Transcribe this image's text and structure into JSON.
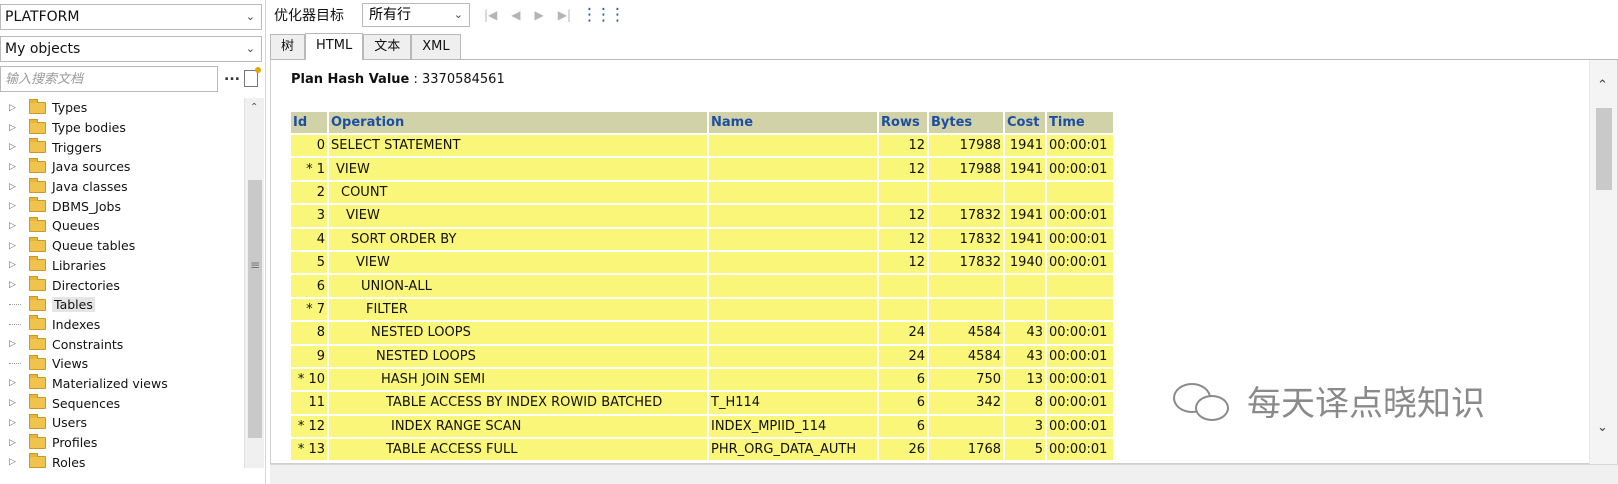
{
  "left_panel": {
    "schema_combo": "PLATFORM",
    "filter_combo": "My objects",
    "search_placeholder": "输入搜索文档",
    "more_button": "...",
    "tree": [
      {
        "label": "Types",
        "folder": true
      },
      {
        "label": "Type bodies",
        "folder": true
      },
      {
        "label": "Triggers",
        "folder": true
      },
      {
        "label": "Java sources",
        "folder": true
      },
      {
        "label": "Java classes",
        "folder": true
      },
      {
        "label": "DBMS_Jobs",
        "folder": true
      },
      {
        "label": "Queues",
        "folder": true
      },
      {
        "label": "Queue tables",
        "folder": true
      },
      {
        "label": "Libraries",
        "folder": true
      },
      {
        "label": "Directories",
        "folder": true
      },
      {
        "label": "Tables",
        "folder": false,
        "selected": true
      },
      {
        "label": "Indexes",
        "folder": false
      },
      {
        "label": "Constraints",
        "folder": true
      },
      {
        "label": "Views",
        "folder": false
      },
      {
        "label": "Materialized views",
        "folder": true
      },
      {
        "label": "Sequences",
        "folder": true
      },
      {
        "label": "Users",
        "folder": true
      },
      {
        "label": "Profiles",
        "folder": true
      },
      {
        "label": "Roles",
        "folder": true
      }
    ]
  },
  "toolbar": {
    "optimizer_label": "优化器目标",
    "optimizer_value": "所有行"
  },
  "tabs": [
    {
      "label": "树",
      "active": false
    },
    {
      "label": "HTML",
      "active": true
    },
    {
      "label": "文本",
      "active": false
    },
    {
      "label": "XML",
      "active": false
    }
  ],
  "plan": {
    "hash_label": "Plan Hash Value",
    "hash_value": ": 3370584561",
    "columns": [
      "Id",
      "Operation",
      "Name",
      "Rows",
      "Bytes",
      "Cost",
      "Time"
    ],
    "rows": [
      {
        "id": "0",
        "op": "SELECT STATEMENT",
        "indent": 0,
        "name": "",
        "rows": "12",
        "bytes": "17988",
        "cost": "1941",
        "time": "00:00:01"
      },
      {
        "id": "* 1",
        "op": "VIEW",
        "indent": 1,
        "name": "",
        "rows": "12",
        "bytes": "17988",
        "cost": "1941",
        "time": "00:00:01"
      },
      {
        "id": "2",
        "op": "COUNT",
        "indent": 2,
        "name": "",
        "rows": "",
        "bytes": "",
        "cost": "",
        "time": ""
      },
      {
        "id": "3",
        "op": "VIEW",
        "indent": 3,
        "name": "",
        "rows": "12",
        "bytes": "17832",
        "cost": "1941",
        "time": "00:00:01"
      },
      {
        "id": "4",
        "op": "SORT ORDER BY",
        "indent": 4,
        "name": "",
        "rows": "12",
        "bytes": "17832",
        "cost": "1941",
        "time": "00:00:01"
      },
      {
        "id": "5",
        "op": "VIEW",
        "indent": 5,
        "name": "",
        "rows": "12",
        "bytes": "17832",
        "cost": "1940",
        "time": "00:00:01"
      },
      {
        "id": "6",
        "op": "UNION-ALL",
        "indent": 6,
        "name": "",
        "rows": "",
        "bytes": "",
        "cost": "",
        "time": ""
      },
      {
        "id": "* 7",
        "op": "FILTER",
        "indent": 7,
        "name": "",
        "rows": "",
        "bytes": "",
        "cost": "",
        "time": ""
      },
      {
        "id": "8",
        "op": "NESTED LOOPS",
        "indent": 8,
        "name": "",
        "rows": "24",
        "bytes": "4584",
        "cost": "43",
        "time": "00:00:01"
      },
      {
        "id": "9",
        "op": "NESTED LOOPS",
        "indent": 9,
        "name": "",
        "rows": "24",
        "bytes": "4584",
        "cost": "43",
        "time": "00:00:01"
      },
      {
        "id": "* 10",
        "op": "HASH JOIN SEMI",
        "indent": 10,
        "name": "",
        "rows": "6",
        "bytes": "750",
        "cost": "13",
        "time": "00:00:01"
      },
      {
        "id": "11",
        "op": "TABLE ACCESS BY INDEX ROWID BATCHED",
        "indent": 11,
        "name": "T_H114",
        "rows": "6",
        "bytes": "342",
        "cost": "8",
        "time": "00:00:01"
      },
      {
        "id": "* 12",
        "op": "INDEX RANGE SCAN",
        "indent": 12,
        "name": "INDEX_MPIID_114",
        "rows": "6",
        "bytes": "",
        "cost": "3",
        "time": "00:00:01"
      },
      {
        "id": "* 13",
        "op": "TABLE ACCESS FULL",
        "indent": 11,
        "name": "PHR_ORG_DATA_AUTH",
        "rows": "26",
        "bytes": "1768",
        "cost": "5",
        "time": "00:00:01"
      }
    ]
  },
  "watermark": "每天译点晓知识"
}
